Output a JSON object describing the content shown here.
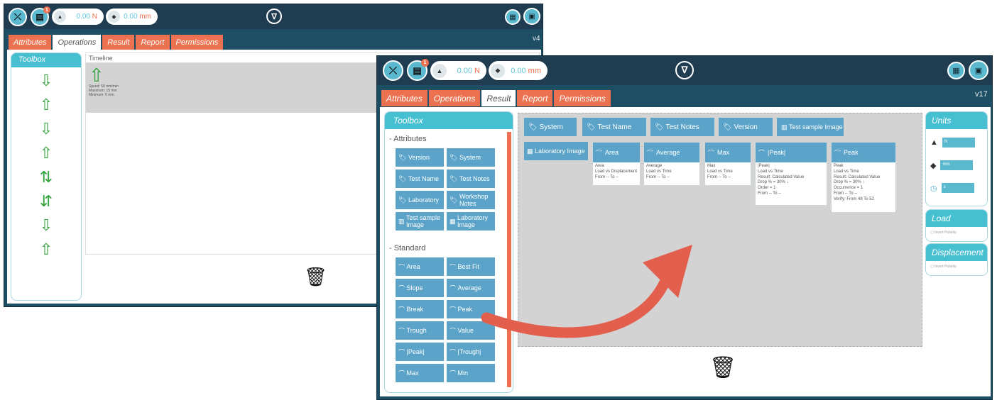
{
  "back": {
    "tabs": [
      "Attributes",
      "Operations",
      "Result",
      "Report",
      "Permissions"
    ],
    "version": "v4",
    "force_value": "0.00",
    "force_unit": "N",
    "disp_value": "0.00",
    "disp_unit": "mm",
    "badge": "1",
    "toolbox": "Toolbox",
    "timeline": "Timeline",
    "op_lines": [
      "Speed: 50 mm/min",
      "Maximum: 15 mm",
      "Minimum: 0 mm"
    ]
  },
  "front": {
    "tabs": [
      "Attributes",
      "Operations",
      "Result",
      "Report",
      "Permissions"
    ],
    "version": "v17",
    "force_value": "0.00",
    "force_unit": "N",
    "disp_value": "0.00",
    "disp_unit": "mm",
    "badge": "1",
    "toolbox": "Toolbox",
    "attr_section": "- Attributes",
    "attr_items": [
      "Version",
      "System",
      "Test Name",
      "Test Notes",
      "Laboratory",
      "Workshop Notes",
      "Test sample Image",
      "Laboratory Image"
    ],
    "std_section": "- Standard",
    "std_items": [
      "Area",
      "Best Fit",
      "Slope",
      "Average",
      "Break",
      "Peak",
      "Trough",
      "Value",
      "|Peak|",
      "|Trough|",
      "Max",
      "Min"
    ],
    "attr_tiles": [
      "System",
      "Test Name",
      "Test Notes",
      "Version",
      "Test sample Image"
    ],
    "lab_tile": "Laboratory Image",
    "cards": [
      {
        "title": "Area",
        "lines": [
          "Area",
          "Load vs Displacement",
          "From -- To --"
        ]
      },
      {
        "title": "Average",
        "lines": [
          "Average",
          "Load vs Time",
          "From -- To --"
        ]
      },
      {
        "title": "Max",
        "lines": [
          "Max",
          "Load vs Time",
          "From -- To --"
        ]
      },
      {
        "title": "|Peak|",
        "lines": [
          "|Peak|",
          "Load vs Time",
          "Result: Calculated Value",
          "Drop % = 30% ↓",
          "Order = 1",
          "From -- To --"
        ]
      },
      {
        "title": "Peak",
        "lines": [
          "Peak",
          "Load vs Time",
          "Result: Calculated Value",
          "Drop % = 30% ↓",
          "Occurrence = 1",
          "From -- To --",
          "Verify: From 48 To 52"
        ]
      }
    ],
    "units_title": "Units",
    "unit_values": [
      "N",
      "mm",
      "s"
    ],
    "load_title": "Load",
    "disp_title": "Displacement",
    "invert": "Invert Polarity"
  },
  "colors": {
    "accent": "#ec7150",
    "header": "#1f3c51",
    "tile": "#5ba3c8",
    "teal": "#46c0d0",
    "arrow": "#e35f4d"
  }
}
